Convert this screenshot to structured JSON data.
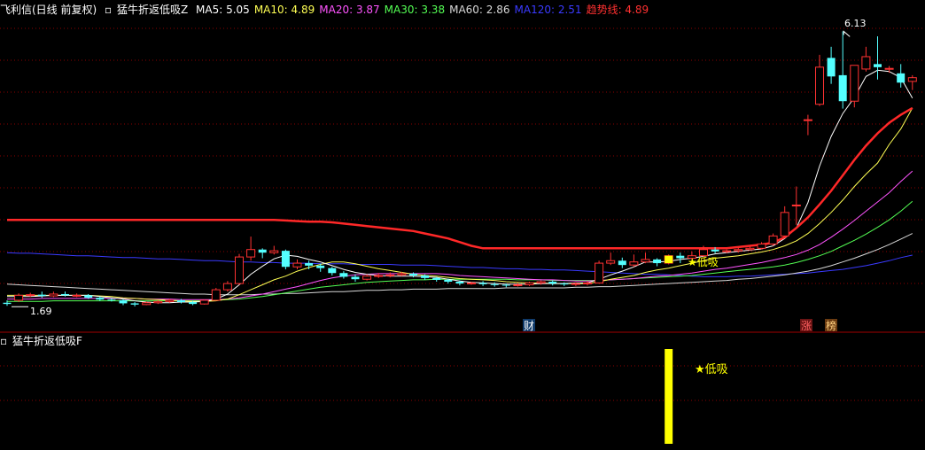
{
  "header": {
    "stock_title": "飞利信(日线 前复权)",
    "indicator_name": "猛牛折返低吸Z",
    "ma": [
      {
        "label": "MA5: 5.05",
        "color": "#ffffff"
      },
      {
        "label": "MA10: 4.89",
        "color": "#ffff54"
      },
      {
        "label": "MA20: 3.87",
        "color": "#ff54ff"
      },
      {
        "label": "MA30: 3.38",
        "color": "#54ff54"
      },
      {
        "label": "MA60: 2.86",
        "color": "#d8d8d8"
      },
      {
        "label": "MA120: 2.51",
        "color": "#3a3aff"
      },
      {
        "label": "趋势线: 4.89",
        "color": "#ff3030"
      }
    ]
  },
  "sub_header": {
    "indicator_name": "猛牛折返低吸F"
  },
  "annotations": {
    "high_label": "6.13",
    "low_label": "1.69",
    "signal_label": "★低吸",
    "sub_signal_label": "★低吸",
    "badge_cai": "财",
    "badge_zhang": "涨",
    "badge_bang": "榜"
  },
  "colors": {
    "up": "#ff3232",
    "down": "#54ffff",
    "ma5": "#ffffff",
    "ma10": "#ffff54",
    "ma20": "#ff54ff",
    "ma30": "#54ff54",
    "ma60": "#d8d8d8",
    "ma120": "#3a3aff",
    "trend": "#ff2828",
    "signal": "#ffff00",
    "grid": "#8b0000"
  },
  "chart_data": {
    "type": "candlestick",
    "ylim": [
      1.55,
      6.35
    ],
    "high_marker": 6.13,
    "low_marker": 1.69,
    "signal_index": 57,
    "candles": [
      [
        1.74,
        1.72,
        1.78,
        1.69
      ],
      [
        1.78,
        1.86,
        1.89,
        1.75
      ],
      [
        1.86,
        1.87,
        1.9,
        1.83
      ],
      [
        1.87,
        1.85,
        1.92,
        1.82
      ],
      [
        1.85,
        1.88,
        1.92,
        1.83
      ],
      [
        1.88,
        1.86,
        1.92,
        1.84
      ],
      [
        1.86,
        1.86,
        1.89,
        1.83
      ],
      [
        1.86,
        1.82,
        1.88,
        1.8
      ],
      [
        1.82,
        1.79,
        1.84,
        1.77
      ],
      [
        1.79,
        1.78,
        1.81,
        1.76
      ],
      [
        1.78,
        1.73,
        1.8,
        1.7
      ],
      [
        1.73,
        1.71,
        1.75,
        1.68
      ],
      [
        1.71,
        1.74,
        1.76,
        1.7
      ],
      [
        1.74,
        1.76,
        1.78,
        1.72
      ],
      [
        1.76,
        1.78,
        1.8,
        1.74
      ],
      [
        1.78,
        1.75,
        1.8,
        1.73
      ],
      [
        1.75,
        1.72,
        1.77,
        1.7
      ],
      [
        1.72,
        1.78,
        1.79,
        1.71
      ],
      [
        1.78,
        1.95,
        1.98,
        1.77
      ],
      [
        1.95,
        2.05,
        2.09,
        1.92
      ],
      [
        2.05,
        2.48,
        2.53,
        2.03
      ],
      [
        2.48,
        2.6,
        2.81,
        2.42
      ],
      [
        2.6,
        2.55,
        2.62,
        2.46
      ],
      [
        2.55,
        2.58,
        2.66,
        2.52
      ],
      [
        2.58,
        2.32,
        2.6,
        2.28
      ],
      [
        2.32,
        2.38,
        2.44,
        2.28
      ],
      [
        2.38,
        2.34,
        2.42,
        2.28
      ],
      [
        2.34,
        2.3,
        2.37,
        2.24
      ],
      [
        2.3,
        2.22,
        2.32,
        2.18
      ],
      [
        2.22,
        2.16,
        2.25,
        2.13
      ],
      [
        2.16,
        2.12,
        2.2,
        2.08
      ],
      [
        2.12,
        2.17,
        2.2,
        2.1
      ],
      [
        2.17,
        2.18,
        2.22,
        2.14
      ],
      [
        2.18,
        2.19,
        2.23,
        2.15
      ],
      [
        2.19,
        2.21,
        2.24,
        2.17
      ],
      [
        2.21,
        2.18,
        2.23,
        2.15
      ],
      [
        2.18,
        2.14,
        2.2,
        2.11
      ],
      [
        2.14,
        2.11,
        2.16,
        2.08
      ],
      [
        2.11,
        2.08,
        2.13,
        2.05
      ],
      [
        2.08,
        2.05,
        2.1,
        2.02
      ],
      [
        2.05,
        2.06,
        2.08,
        2.03
      ],
      [
        2.06,
        2.04,
        2.09,
        2.01
      ],
      [
        2.04,
        2.03,
        2.07,
        2.0
      ],
      [
        2.03,
        2.02,
        2.05,
        1.99
      ],
      [
        2.02,
        2.03,
        2.06,
        2.0
      ],
      [
        2.03,
        2.06,
        2.08,
        2.01
      ],
      [
        2.06,
        2.08,
        2.1,
        2.03
      ],
      [
        2.08,
        2.05,
        2.1,
        2.02
      ],
      [
        2.05,
        2.04,
        2.07,
        2.01
      ],
      [
        2.04,
        2.05,
        2.07,
        2.01
      ],
      [
        2.05,
        2.06,
        2.09,
        2.02
      ],
      [
        2.06,
        2.38,
        2.42,
        2.05
      ],
      [
        2.38,
        2.42,
        2.55,
        2.35
      ],
      [
        2.42,
        2.35,
        2.47,
        2.3
      ],
      [
        2.35,
        2.4,
        2.52,
        2.32
      ],
      [
        2.4,
        2.44,
        2.55,
        2.38
      ],
      [
        2.44,
        2.38,
        2.46,
        2.33
      ],
      [
        2.38,
        2.5,
        2.52,
        2.36
      ],
      [
        2.5,
        2.46,
        2.55,
        2.38
      ],
      [
        2.46,
        2.5,
        2.57,
        2.43
      ],
      [
        2.5,
        2.6,
        2.66,
        2.48
      ],
      [
        2.6,
        2.57,
        2.64,
        2.54
      ],
      [
        2.57,
        2.58,
        2.6,
        2.54
      ],
      [
        2.58,
        2.6,
        2.63,
        2.55
      ],
      [
        2.6,
        2.62,
        2.65,
        2.58
      ],
      [
        2.62,
        2.69,
        2.72,
        2.6
      ],
      [
        2.69,
        2.82,
        2.86,
        2.66
      ],
      [
        2.82,
        3.2,
        3.3,
        2.8
      ],
      [
        3.32,
        3.32,
        3.62,
        3.0
      ],
      [
        4.7,
        4.7,
        4.78,
        4.45
      ],
      [
        4.95,
        5.55,
        5.75,
        4.92
      ],
      [
        5.7,
        5.4,
        5.88,
        5.28
      ],
      [
        5.42,
        5.0,
        6.13,
        4.88
      ],
      [
        5.0,
        5.58,
        5.58,
        4.9
      ],
      [
        5.52,
        5.72,
        5.88,
        5.48
      ],
      [
        5.6,
        5.55,
        6.05,
        5.35
      ],
      [
        5.53,
        5.53,
        5.57,
        5.46
      ],
      [
        5.45,
        5.3,
        5.6,
        5.22
      ],
      [
        5.32,
        5.38,
        5.42,
        5.18
      ]
    ],
    "ma5": [
      1.84,
      1.84,
      1.84,
      1.85,
      1.86,
      1.86,
      1.86,
      1.86,
      1.84,
      1.82,
      1.8,
      1.77,
      1.75,
      1.74,
      1.74,
      1.75,
      1.75,
      1.76,
      1.8,
      1.88,
      2.03,
      2.2,
      2.33,
      2.45,
      2.51,
      2.49,
      2.44,
      2.4,
      2.34,
      2.28,
      2.23,
      2.2,
      2.18,
      2.17,
      2.17,
      2.17,
      2.16,
      2.15,
      2.12,
      2.09,
      2.07,
      2.06,
      2.05,
      2.04,
      2.04,
      2.04,
      2.05,
      2.05,
      2.05,
      2.06,
      2.06,
      2.12,
      2.19,
      2.25,
      2.32,
      2.4,
      2.4,
      2.41,
      2.44,
      2.46,
      2.49,
      2.53,
      2.55,
      2.57,
      2.59,
      2.61,
      2.66,
      2.78,
      2.95,
      3.36,
      3.95,
      4.43,
      4.8,
      5.06,
      5.4,
      5.5,
      5.48,
      5.38,
      5.05
    ],
    "ma10": [
      1.86,
      1.86,
      1.86,
      1.86,
      1.86,
      1.86,
      1.86,
      1.86,
      1.85,
      1.84,
      1.82,
      1.81,
      1.8,
      1.79,
      1.78,
      1.77,
      1.76,
      1.76,
      1.77,
      1.8,
      1.87,
      1.95,
      2.03,
      2.11,
      2.17,
      2.25,
      2.31,
      2.36,
      2.4,
      2.4,
      2.37,
      2.33,
      2.29,
      2.26,
      2.23,
      2.2,
      2.18,
      2.17,
      2.15,
      2.13,
      2.12,
      2.11,
      2.1,
      2.08,
      2.07,
      2.06,
      2.06,
      2.05,
      2.05,
      2.05,
      2.05,
      2.08,
      2.12,
      2.15,
      2.18,
      2.23,
      2.27,
      2.3,
      2.34,
      2.38,
      2.42,
      2.46,
      2.48,
      2.5,
      2.53,
      2.56,
      2.6,
      2.66,
      2.74,
      2.86,
      3.02,
      3.2,
      3.4,
      3.62,
      3.82,
      4.0,
      4.3,
      4.55,
      4.89
    ],
    "ma20": [
      1.8,
      1.8,
      1.8,
      1.81,
      1.81,
      1.81,
      1.81,
      1.81,
      1.81,
      1.81,
      1.81,
      1.81,
      1.8,
      1.8,
      1.8,
      1.79,
      1.79,
      1.79,
      1.79,
      1.8,
      1.82,
      1.85,
      1.88,
      1.92,
      1.96,
      2.0,
      2.05,
      2.1,
      2.14,
      2.17,
      2.19,
      2.2,
      2.21,
      2.21,
      2.21,
      2.21,
      2.21,
      2.21,
      2.2,
      2.18,
      2.17,
      2.16,
      2.15,
      2.14,
      2.13,
      2.12,
      2.11,
      2.11,
      2.1,
      2.09,
      2.09,
      2.1,
      2.11,
      2.12,
      2.13,
      2.15,
      2.17,
      2.18,
      2.2,
      2.22,
      2.25,
      2.28,
      2.3,
      2.33,
      2.36,
      2.39,
      2.43,
      2.47,
      2.52,
      2.59,
      2.68,
      2.8,
      2.93,
      3.07,
      3.22,
      3.37,
      3.52,
      3.7,
      3.87
    ],
    "ma30": [
      1.76,
      1.76,
      1.76,
      1.76,
      1.77,
      1.77,
      1.77,
      1.77,
      1.77,
      1.77,
      1.77,
      1.77,
      1.77,
      1.77,
      1.77,
      1.77,
      1.77,
      1.77,
      1.78,
      1.79,
      1.8,
      1.82,
      1.84,
      1.87,
      1.9,
      1.93,
      1.96,
      1.99,
      2.01,
      2.03,
      2.05,
      2.07,
      2.08,
      2.09,
      2.1,
      2.11,
      2.11,
      2.12,
      2.12,
      2.12,
      2.12,
      2.12,
      2.12,
      2.12,
      2.11,
      2.11,
      2.11,
      2.1,
      2.1,
      2.1,
      2.1,
      2.1,
      2.11,
      2.12,
      2.13,
      2.14,
      2.15,
      2.16,
      2.17,
      2.18,
      2.2,
      2.22,
      2.24,
      2.26,
      2.28,
      2.3,
      2.32,
      2.35,
      2.39,
      2.44,
      2.5,
      2.57,
      2.66,
      2.75,
      2.85,
      2.96,
      3.08,
      3.22,
      3.38
    ],
    "ma60": [
      2.04,
      2.03,
      2.02,
      2.01,
      2.0,
      1.99,
      1.98,
      1.97,
      1.96,
      1.95,
      1.94,
      1.93,
      1.92,
      1.91,
      1.9,
      1.89,
      1.88,
      1.88,
      1.87,
      1.87,
      1.87,
      1.87,
      1.88,
      1.88,
      1.89,
      1.89,
      1.9,
      1.91,
      1.92,
      1.92,
      1.93,
      1.94,
      1.94,
      1.95,
      1.95,
      1.96,
      1.96,
      1.96,
      1.97,
      1.97,
      1.97,
      1.97,
      1.97,
      1.98,
      1.98,
      1.98,
      1.98,
      1.98,
      1.98,
      1.99,
      1.99,
      2.0,
      2.0,
      2.01,
      2.02,
      2.03,
      2.04,
      2.05,
      2.06,
      2.07,
      2.08,
      2.09,
      2.1,
      2.12,
      2.13,
      2.15,
      2.17,
      2.19,
      2.22,
      2.25,
      2.29,
      2.34,
      2.4,
      2.46,
      2.53,
      2.6,
      2.68,
      2.77,
      2.86
    ],
    "ma120": [
      2.55,
      2.54,
      2.54,
      2.53,
      2.52,
      2.51,
      2.5,
      2.5,
      2.49,
      2.48,
      2.47,
      2.47,
      2.46,
      2.45,
      2.45,
      2.44,
      2.43,
      2.42,
      2.42,
      2.41,
      2.4,
      2.4,
      2.39,
      2.39,
      2.38,
      2.38,
      2.38,
      2.37,
      2.37,
      2.37,
      2.36,
      2.36,
      2.36,
      2.36,
      2.35,
      2.35,
      2.35,
      2.34,
      2.33,
      2.32,
      2.31,
      2.31,
      2.3,
      2.29,
      2.29,
      2.28,
      2.28,
      2.27,
      2.27,
      2.26,
      2.25,
      2.24,
      2.23,
      2.22,
      2.21,
      2.2,
      2.2,
      2.19,
      2.18,
      2.17,
      2.16,
      2.16,
      2.16,
      2.17,
      2.17,
      2.18,
      2.19,
      2.2,
      2.21,
      2.22,
      2.24,
      2.26,
      2.28,
      2.31,
      2.34,
      2.38,
      2.42,
      2.47,
      2.51
    ],
    "trend": [
      3.08,
      3.08,
      3.08,
      3.08,
      3.08,
      3.08,
      3.08,
      3.08,
      3.08,
      3.08,
      3.08,
      3.08,
      3.08,
      3.08,
      3.08,
      3.08,
      3.08,
      3.08,
      3.08,
      3.08,
      3.08,
      3.08,
      3.08,
      3.08,
      3.07,
      3.06,
      3.05,
      3.05,
      3.04,
      3.02,
      3.0,
      2.98,
      2.96,
      2.94,
      2.92,
      2.9,
      2.86,
      2.82,
      2.78,
      2.72,
      2.66,
      2.62,
      2.62,
      2.62,
      2.62,
      2.62,
      2.62,
      2.62,
      2.62,
      2.62,
      2.62,
      2.62,
      2.62,
      2.62,
      2.62,
      2.62,
      2.62,
      2.62,
      2.62,
      2.62,
      2.62,
      2.62,
      2.62,
      2.64,
      2.66,
      2.68,
      2.71,
      2.8,
      2.95,
      3.12,
      3.33,
      3.55,
      3.8,
      4.05,
      4.28,
      4.48,
      4.65,
      4.78,
      4.89
    ]
  }
}
